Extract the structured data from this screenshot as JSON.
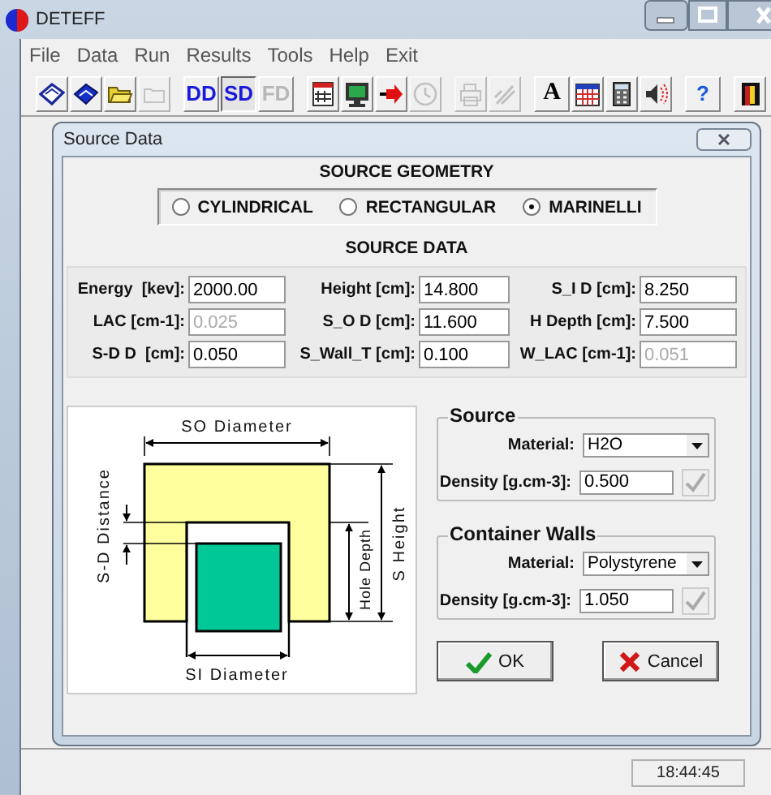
{
  "window": {
    "title": "DETEFF"
  },
  "menu": [
    "File",
    "Data",
    "Run",
    "Results",
    "Tools",
    "Help",
    "Exit"
  ],
  "toolbar_groups": [
    {
      "items": [
        {
          "kind": "icon",
          "disabled": false
        },
        {
          "kind": "icon",
          "disabled": false
        },
        {
          "kind": "icon",
          "disabled": false
        },
        {
          "kind": "icon",
          "disabled": true
        }
      ]
    },
    {
      "items": [
        {
          "kind": "text",
          "label": "DD",
          "selected": false,
          "disabled": false,
          "color": "#1a1adc"
        },
        {
          "kind": "text",
          "label": "SD",
          "selected": true,
          "disabled": false,
          "color": "#1a1adc"
        },
        {
          "kind": "text",
          "label": "FD",
          "selected": false,
          "disabled": true
        }
      ]
    },
    {
      "items": [
        {
          "kind": "icon",
          "disabled": false
        },
        {
          "kind": "icon",
          "disabled": false
        },
        {
          "kind": "icon",
          "disabled": false
        },
        {
          "kind": "icon",
          "disabled": true
        }
      ]
    },
    {
      "items": [
        {
          "kind": "icon",
          "disabled": true
        },
        {
          "kind": "icon",
          "disabled": true
        }
      ]
    },
    {
      "items": [
        {
          "kind": "text",
          "label": "A",
          "selected": false,
          "disabled": false,
          "color": "#000000"
        },
        {
          "kind": "icon",
          "disabled": false
        },
        {
          "kind": "icon",
          "disabled": false
        },
        {
          "kind": "icon",
          "disabled": false
        }
      ]
    },
    {
      "items": [
        {
          "kind": "text",
          "label": "?",
          "selected": false,
          "disabled": false,
          "color": "#1a5adc"
        }
      ]
    },
    {
      "items": [
        {
          "kind": "icon",
          "disabled": false
        }
      ]
    }
  ],
  "dialog": {
    "title": "Source Data",
    "geometry": {
      "heading": "SOURCE GEOMETRY",
      "options": [
        {
          "label": "CYLINDRICAL",
          "selected": false
        },
        {
          "label": "RECTANGULAR",
          "selected": false
        },
        {
          "label": "MARINELLI",
          "selected": true
        }
      ]
    },
    "source_data": {
      "heading": "SOURCE DATA",
      "fields": [
        {
          "label": "Energy  [kev]:",
          "value": "2000.00",
          "disabled": false
        },
        {
          "label": "Height [cm]:",
          "value": "14.800",
          "disabled": false
        },
        {
          "label": "S_I D [cm]:",
          "value": "8.250",
          "disabled": false
        },
        {
          "label": "LAC [cm-1]:",
          "value": "0.025",
          "disabled": true
        },
        {
          "label": "S_O D [cm]:",
          "value": "11.600",
          "disabled": false
        },
        {
          "label": "H Depth [cm]:",
          "value": "7.500",
          "disabled": false
        },
        {
          "label": "S-D D  [cm]:",
          "value": "0.050",
          "disabled": false
        },
        {
          "label": "S_Wall_T [cm]:",
          "value": "0.100",
          "disabled": false
        },
        {
          "label": "W_LAC [cm-1]:",
          "value": "0.051",
          "disabled": true
        }
      ]
    },
    "diagram": {
      "labels": [
        "SO Diameter",
        "S-D Distance",
        "Hole Depth",
        "S Height",
        "SI Diameter"
      ]
    },
    "groups": [
      {
        "title": "Source",
        "material_label": "Material:",
        "material": "H2O",
        "density_label": "Density [g.cm-3]:",
        "density": "0.500"
      },
      {
        "title": "Container Walls",
        "material_label": "Material:",
        "material": "Polystyrene",
        "density_label": "Density [g.cm-3]:",
        "density": "1.050"
      }
    ],
    "buttons": [
      {
        "kind": "ok",
        "label": "OK"
      },
      {
        "kind": "cancel",
        "label": "Cancel"
      }
    ]
  },
  "status_bar": {
    "time": "18:44:45"
  }
}
